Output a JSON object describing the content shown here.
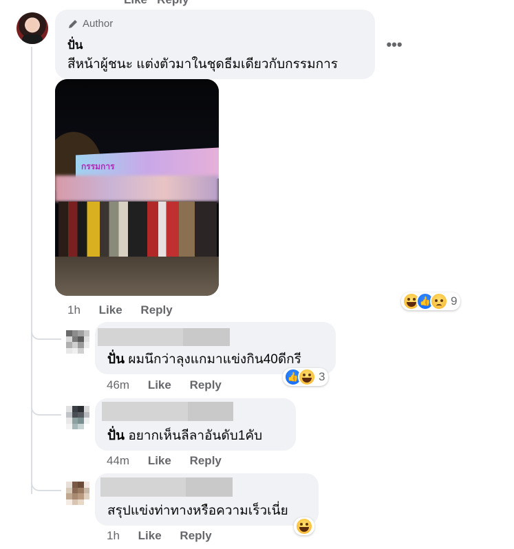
{
  "top_partial": {
    "label": "Like   Reply"
  },
  "post": {
    "author_badge": "Author",
    "author_name": "ปั่น",
    "text": "สีหน้าผู้ชนะ แต่งตัวมาในชุดธีมเดียวกับกรรมการ",
    "photo_sign": "กรรมการ",
    "time": "1h",
    "like": "Like",
    "reply": "Reply",
    "reaction_count": "9",
    "reactions": [
      "haha",
      "like",
      "sad"
    ]
  },
  "replies": [
    {
      "tag": "ปั่น",
      "text": "ผมนึกว่าลุงแกมาแข่งกิน40ดีกรี",
      "time": "46m",
      "like": "Like",
      "reply": "Reply",
      "reaction_count": "3",
      "reactions": [
        "like",
        "haha"
      ]
    },
    {
      "tag": "ปั่น",
      "text": "อยากเห็นลีลาอันดับ1คับ",
      "time": "44m",
      "like": "Like",
      "reply": "Reply"
    },
    {
      "tag": "",
      "text": "สรุปแข่งท่าทางหรือความเร็วเนี่ย",
      "time": "1h",
      "like": "Like",
      "reply": "Reply",
      "reactions": [
        "haha"
      ]
    }
  ],
  "more_options_icon": "more-horizontal-icon",
  "colors": {
    "bubble": "#f0f2f5",
    "meta": "#65676b",
    "like_blue": "#0866ff"
  }
}
